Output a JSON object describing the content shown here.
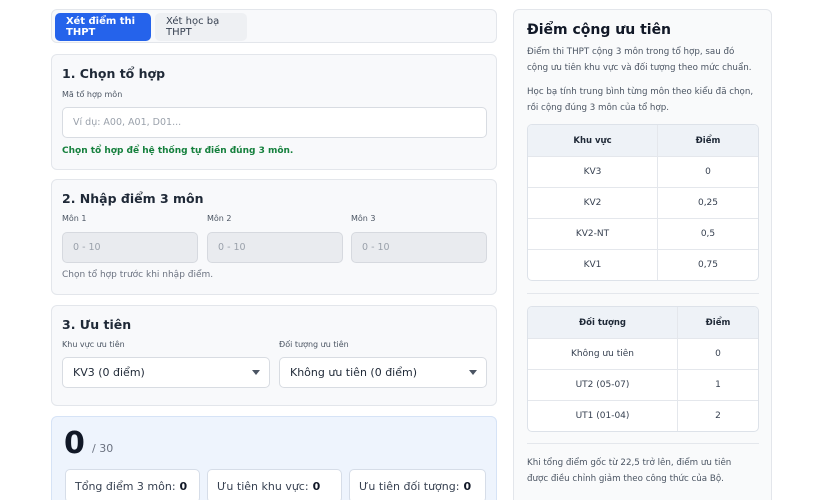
{
  "tabs": [
    {
      "label": "Xét điểm thi THPT",
      "active": true
    },
    {
      "label": "Xét học bạ THPT",
      "active": false
    }
  ],
  "section1": {
    "title": "1. Chọn tổ hợp",
    "field_label": "Mã tổ hợp môn",
    "placeholder": "Ví dụ: A00, A01, D01...",
    "hint": "Chọn tổ hợp để hệ thống tự điền đúng 3 môn."
  },
  "section2": {
    "title": "2. Nhập điểm 3 môn",
    "subjects": [
      {
        "label": "Môn 1",
        "placeholder": "0 - 10"
      },
      {
        "label": "Môn 2",
        "placeholder": "0 - 10"
      },
      {
        "label": "Môn 3",
        "placeholder": "0 - 10"
      }
    ],
    "hint": "Chọn tổ hợp trước khi nhập điểm."
  },
  "section3": {
    "title": "3. Ưu tiên",
    "region_label": "Khu vực ưu tiên",
    "region_value": "KV3 (0 điểm)",
    "object_label": "Đối tượng ưu tiên",
    "object_value": "Không ưu tiên (0 điểm)"
  },
  "result": {
    "total": "0",
    "max": "/ 30",
    "stats": [
      {
        "label": "Tổng điểm 3 môn:",
        "value": "0"
      },
      {
        "label": "Ưu tiên khu vực:",
        "value": "0"
      },
      {
        "label": "Ưu tiên đối tượng:",
        "value": "0"
      }
    ]
  },
  "sidebar": {
    "title": "Điểm cộng ưu tiên",
    "para1_line1": "Điểm thi THPT cộng 3 môn trong tổ hợp, sau đó",
    "para1_line2": "cộng ưu tiên khu vực và đối tượng theo mức chuẩn.",
    "para2_line1": "Học bạ tính trung bình từng môn theo kiểu đã chọn,",
    "para2_line2": "rồi cộng đúng 3 môn của tổ hợp.",
    "region_table": {
      "headers": [
        "Khu vực",
        "Điểm"
      ],
      "rows": [
        [
          "KV3",
          "0"
        ],
        [
          "KV2",
          "0,25"
        ],
        [
          "KV2-NT",
          "0,5"
        ],
        [
          "KV1",
          "0,75"
        ]
      ]
    },
    "object_table": {
      "headers": [
        "Đối tượng",
        "Điểm"
      ],
      "rows": [
        [
          "Không ưu tiên",
          "0"
        ],
        [
          "UT2 (05-07)",
          "1"
        ],
        [
          "UT1 (01-04)",
          "2"
        ]
      ]
    },
    "note_line1": "Khi tổng điểm gốc từ 22,5 trở lên, điểm ưu tiên",
    "note_line2": "được điều chỉnh giảm theo công thức của Bộ."
  }
}
